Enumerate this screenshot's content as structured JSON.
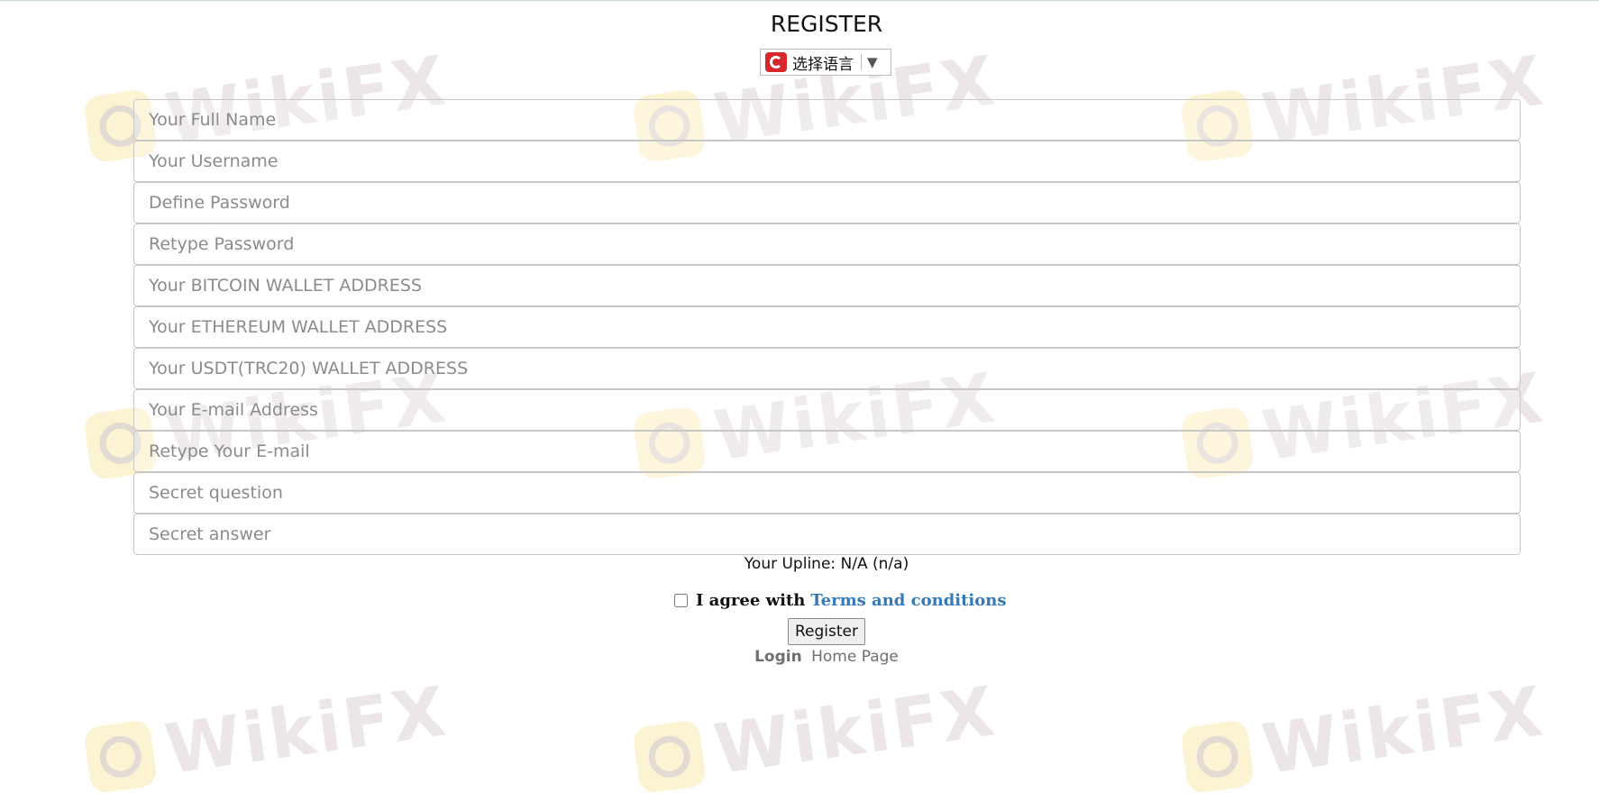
{
  "header": {
    "title": "REGISTER",
    "language_selector": {
      "label": "选择语言",
      "icon": "translate-logo-icon",
      "arrow": "▼"
    }
  },
  "watermark": {
    "text": "WikiFX",
    "icon": "wikifx-logo-icon"
  },
  "form": {
    "fields": [
      {
        "placeholder": "Your Full Name",
        "value": ""
      },
      {
        "placeholder": "Your Username",
        "value": ""
      },
      {
        "placeholder": "Define Password",
        "value": ""
      },
      {
        "placeholder": "Retype Password",
        "value": ""
      },
      {
        "placeholder": "Your BITCOIN WALLET ADDRESS",
        "value": ""
      },
      {
        "placeholder": "Your ETHEREUM WALLET ADDRESS",
        "value": ""
      },
      {
        "placeholder": "Your USDT(TRC20) WALLET ADDRESS",
        "value": ""
      },
      {
        "placeholder": "Your E-mail Address",
        "value": ""
      },
      {
        "placeholder": "Retype Your E-mail",
        "value": ""
      },
      {
        "placeholder": "Secret question",
        "value": ""
      },
      {
        "placeholder": "Secret answer",
        "value": ""
      }
    ],
    "upline": "Your Upline: N/A (n/a)",
    "agree_text": "I agree with",
    "terms_link": "Terms and conditions",
    "agree_checked": false,
    "register_label": "Register"
  },
  "footer": {
    "login_label": "Login",
    "home_label": "Home Page"
  },
  "colors": {
    "link": "#337ab7",
    "field_border": "#c7c7c7",
    "muted_link": "#6f6f6f"
  }
}
